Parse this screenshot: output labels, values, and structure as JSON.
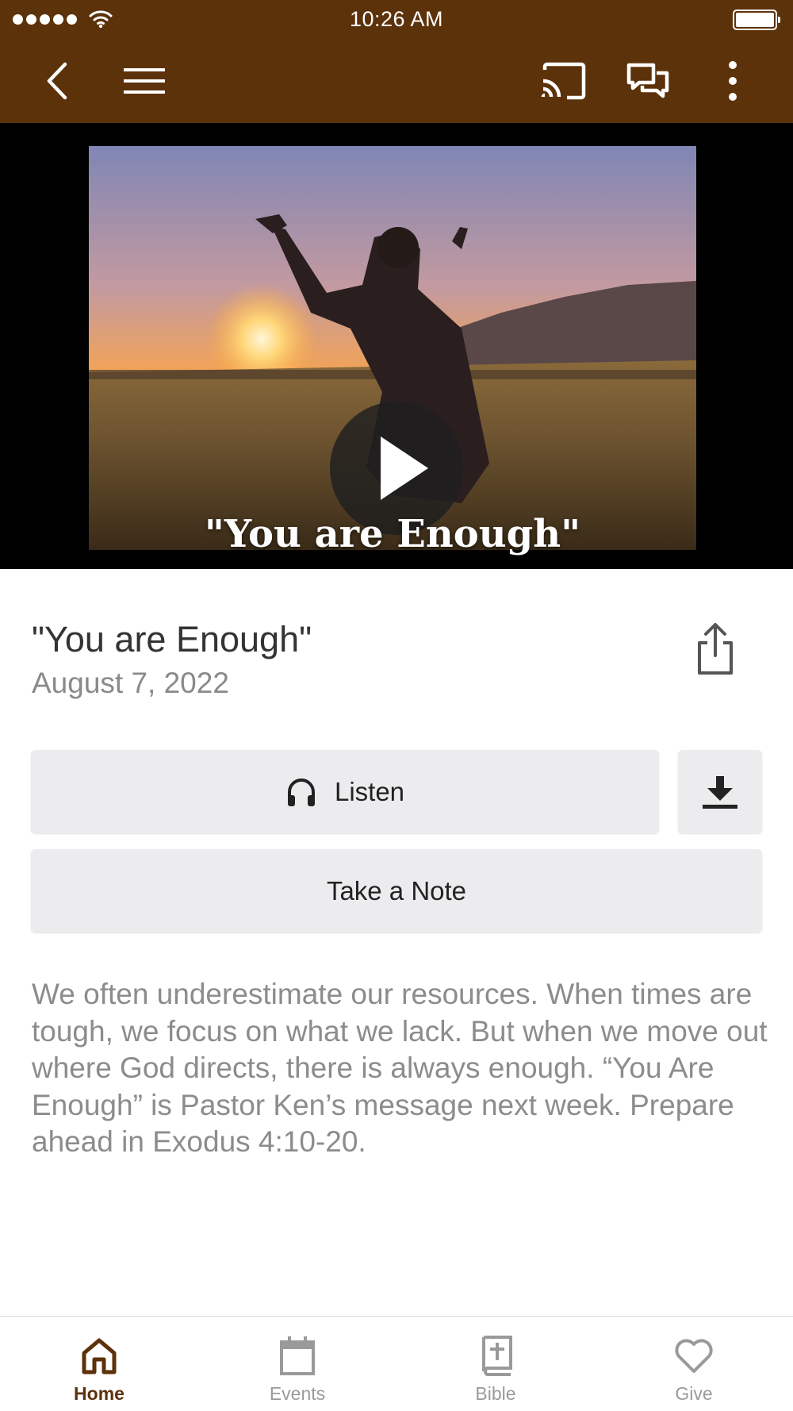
{
  "status_bar": {
    "time": "10:26 AM"
  },
  "app_bar": {
    "icons": [
      "back-icon",
      "menu-icon",
      "cast-icon",
      "chat-icon",
      "more-icon"
    ],
    "color": "#5c320b"
  },
  "video": {
    "overlay_title": "\"You are Enough\"",
    "play_icon": "play-icon"
  },
  "sermon": {
    "title": "\"You are Enough\"",
    "date": "August 7, 2022",
    "share_icon": "share-icon"
  },
  "actions": {
    "listen_label": "Listen",
    "listen_icon": "headphones-icon",
    "download_icon": "download-icon",
    "note_label": "Take a Note"
  },
  "description": "We often underestimate our resources. When times are tough, we focus on what we lack. But when we move out where God directs, there is always enough. “You Are Enough” is Pastor Ken’s message next week. Prepare ahead in Exodus 4:10-20.",
  "tabs": [
    {
      "label": "Home",
      "icon": "home-icon",
      "active": true
    },
    {
      "label": "Events",
      "icon": "calendar-icon",
      "active": false
    },
    {
      "label": "Bible",
      "icon": "bible-icon",
      "active": false
    },
    {
      "label": "Give",
      "icon": "heart-icon",
      "active": false
    }
  ],
  "colors": {
    "brand": "#5c320b",
    "button_bg": "#ececee",
    "muted_text": "#8c8c8c"
  }
}
